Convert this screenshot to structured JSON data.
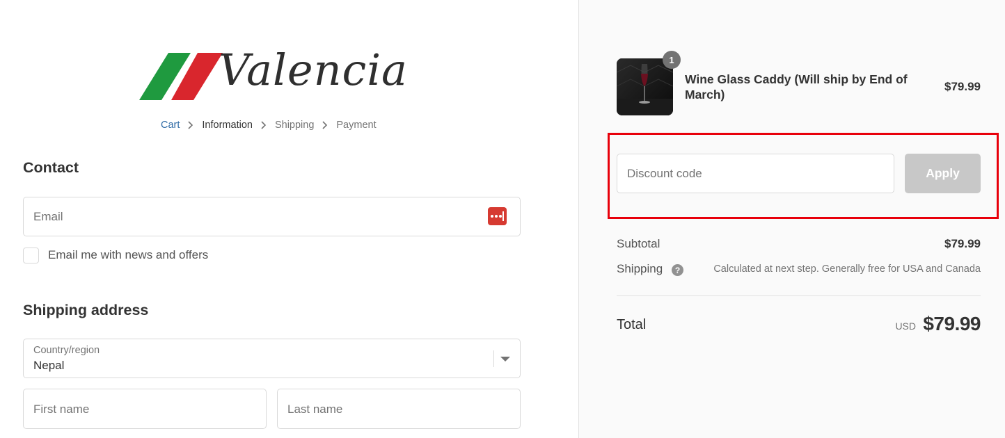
{
  "brand": {
    "name": "Valencia"
  },
  "breadcrumb": {
    "items": [
      "Cart",
      "Information",
      "Shipping",
      "Payment"
    ]
  },
  "contact": {
    "title": "Contact",
    "email_placeholder": "Email",
    "newsletter_label": "Email me with news and offers"
  },
  "shipping_address": {
    "title": "Shipping address",
    "country_label": "Country/region",
    "country_value": "Nepal",
    "first_name_placeholder": "First name",
    "last_name_placeholder": "Last name"
  },
  "order": {
    "item": {
      "name": "Wine Glass Caddy (Will ship by End of March)",
      "quantity": "1",
      "price": "$79.99"
    },
    "discount": {
      "placeholder": "Discount code",
      "apply_label": "Apply"
    },
    "subtotal_label": "Subtotal",
    "subtotal_value": "$79.99",
    "shipping_label": "Shipping",
    "shipping_note": "Calculated at next step. Generally free for USA and Canada",
    "total_label": "Total",
    "currency": "USD",
    "total_value": "$79.99"
  },
  "colors": {
    "accent_link": "#2e6aa5",
    "highlight": "#e8000b",
    "flag_green": "#1f9a3f",
    "flag_red": "#d9262d",
    "password_manager": "#d63a31"
  }
}
